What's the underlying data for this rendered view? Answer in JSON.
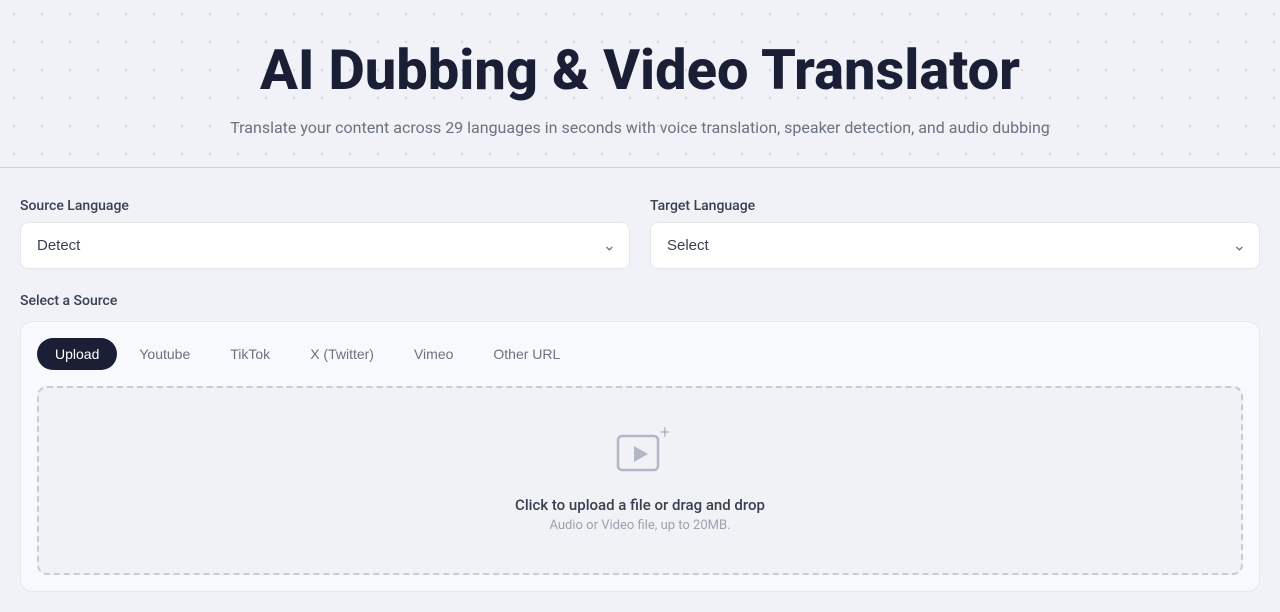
{
  "hero": {
    "title": "AI Dubbing & Video Translator",
    "subtitle": "Translate your content across 29 languages in seconds with voice translation, speaker detection, and audio dubbing"
  },
  "form": {
    "source_language_label": "Source Language",
    "source_language_value": "Detect",
    "target_language_label": "Target Language",
    "target_language_value": "Select",
    "select_source_label": "Select a Source"
  },
  "tabs": [
    {
      "id": "upload",
      "label": "Upload",
      "active": true
    },
    {
      "id": "youtube",
      "label": "Youtube",
      "active": false
    },
    {
      "id": "tiktok",
      "label": "TikTok",
      "active": false
    },
    {
      "id": "twitter",
      "label": "X (Twitter)",
      "active": false
    },
    {
      "id": "vimeo",
      "label": "Vimeo",
      "active": false
    },
    {
      "id": "other",
      "label": "Other URL",
      "active": false
    }
  ],
  "upload": {
    "main_text": "Click to upload a file or drag and drop",
    "sub_text": "Audio or Video file, up to 20MB."
  },
  "colors": {
    "primary_dark": "#1a1f36",
    "accent": "#6366f1"
  }
}
